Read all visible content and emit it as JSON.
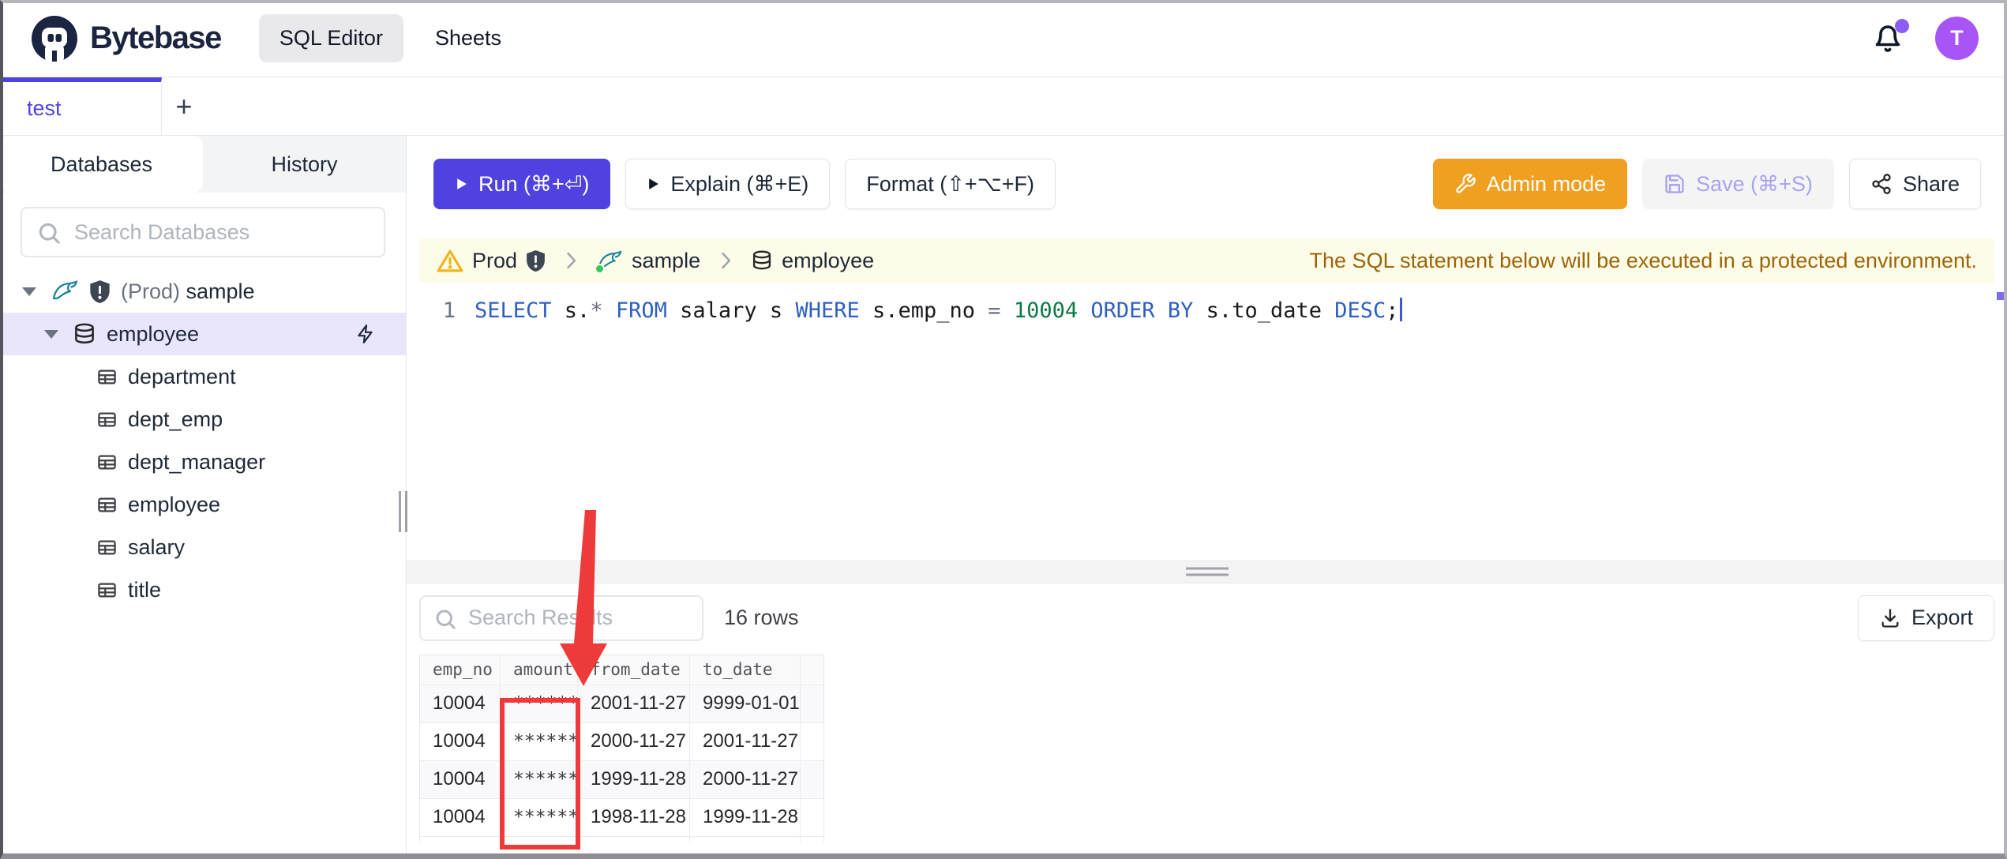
{
  "header": {
    "brand": "Bytebase",
    "nav": [
      {
        "label": "SQL Editor",
        "active": true
      },
      {
        "label": "Sheets",
        "active": false
      }
    ],
    "bell_icon": "bell-icon",
    "notification_badge_color": "#8b5cf6",
    "avatar_letter": "T",
    "avatar_color": "#a855f7"
  },
  "tab_bar": {
    "tabs": [
      {
        "label": "test",
        "active": true
      }
    ],
    "add_button": "+"
  },
  "sidebar": {
    "tabs": [
      {
        "label": "Databases",
        "active": true
      },
      {
        "label": "History",
        "active": false
      }
    ],
    "search": {
      "placeholder": "Search Databases",
      "value": "",
      "icon": "search-icon"
    },
    "connection": {
      "env_prefix": "(Prod)",
      "name": "sample",
      "icons": [
        "caret-down-icon",
        "mysql-dolphin-icon",
        "shield-alert-icon"
      ]
    },
    "database": {
      "name": "employee",
      "icons": [
        "caret-down-icon",
        "database-icon",
        "lightning-icon"
      ],
      "selected": true
    },
    "tables": [
      "department",
      "dept_emp",
      "dept_manager",
      "employee",
      "salary",
      "title"
    ],
    "table_icon": "table-icon"
  },
  "toolbar": {
    "run_label": "Run (⌘+⏎)",
    "explain_label": "Explain (⌘+E)",
    "format_label": "Format (⇧+⌥+F)",
    "admin_label": "Admin mode",
    "admin_icon": "wrench-icon",
    "save_label": "Save (⌘+S)",
    "save_icon": "floppy-icon",
    "save_disabled": true,
    "share_label": "Share",
    "share_icon": "share-icon",
    "run_color": "#4f42e0",
    "admin_color": "#f0a020"
  },
  "notice": {
    "warning_icon": "warning-triangle-icon",
    "environment": "Prod",
    "environment_icon": "shield-alert-icon",
    "database": "sample",
    "database_icon": "mysql-dolphin-icon",
    "database_status_dot": "#34c759",
    "table": "employee",
    "table_icon": "database-icon",
    "message": "The SQL statement below will be executed in a protected environment.",
    "background": "#fdfce8"
  },
  "editor": {
    "line_number": "1",
    "sql": "SELECT s.* FROM salary s WHERE s.emp_no = 10004 ORDER BY s.to_date DESC;",
    "tokens": [
      {
        "t": "SELECT",
        "c": "kw"
      },
      {
        "t": " s.",
        "c": "plain"
      },
      {
        "t": "*",
        "c": "op"
      },
      {
        "t": " ",
        "c": "plain"
      },
      {
        "t": "FROM",
        "c": "kw"
      },
      {
        "t": " salary s ",
        "c": "plain"
      },
      {
        "t": "WHERE",
        "c": "kw"
      },
      {
        "t": " s.emp_no ",
        "c": "plain"
      },
      {
        "t": "=",
        "c": "op"
      },
      {
        "t": " ",
        "c": "plain"
      },
      {
        "t": "10004",
        "c": "num"
      },
      {
        "t": " ",
        "c": "plain"
      },
      {
        "t": "ORDER BY",
        "c": "kw"
      },
      {
        "t": " s.to_date ",
        "c": "plain"
      },
      {
        "t": "DESC",
        "c": "kw"
      },
      {
        "t": ";",
        "c": "plain"
      }
    ]
  },
  "results": {
    "search": {
      "placeholder": "Search Results",
      "value": "",
      "icon": "search-icon"
    },
    "row_count": "16 rows",
    "export_label": "Export",
    "export_icon": "download-icon",
    "table": {
      "columns": [
        "emp_no",
        "amount",
        "from_date",
        "to_date"
      ],
      "rows": [
        [
          "10004",
          "******",
          "2001-11-27",
          "9999-01-01"
        ],
        [
          "10004",
          "******",
          "2000-11-27",
          "2001-11-27"
        ],
        [
          "10004",
          "******",
          "1999-11-28",
          "2000-11-27"
        ],
        [
          "10004",
          "******",
          "1998-11-28",
          "1999-11-28"
        ]
      ]
    }
  },
  "annotations": {
    "color": "#ee3a3a",
    "arrow": "red arrow pointing down at the amount column header",
    "box": "red rectangle outlining the masked amount column values"
  }
}
